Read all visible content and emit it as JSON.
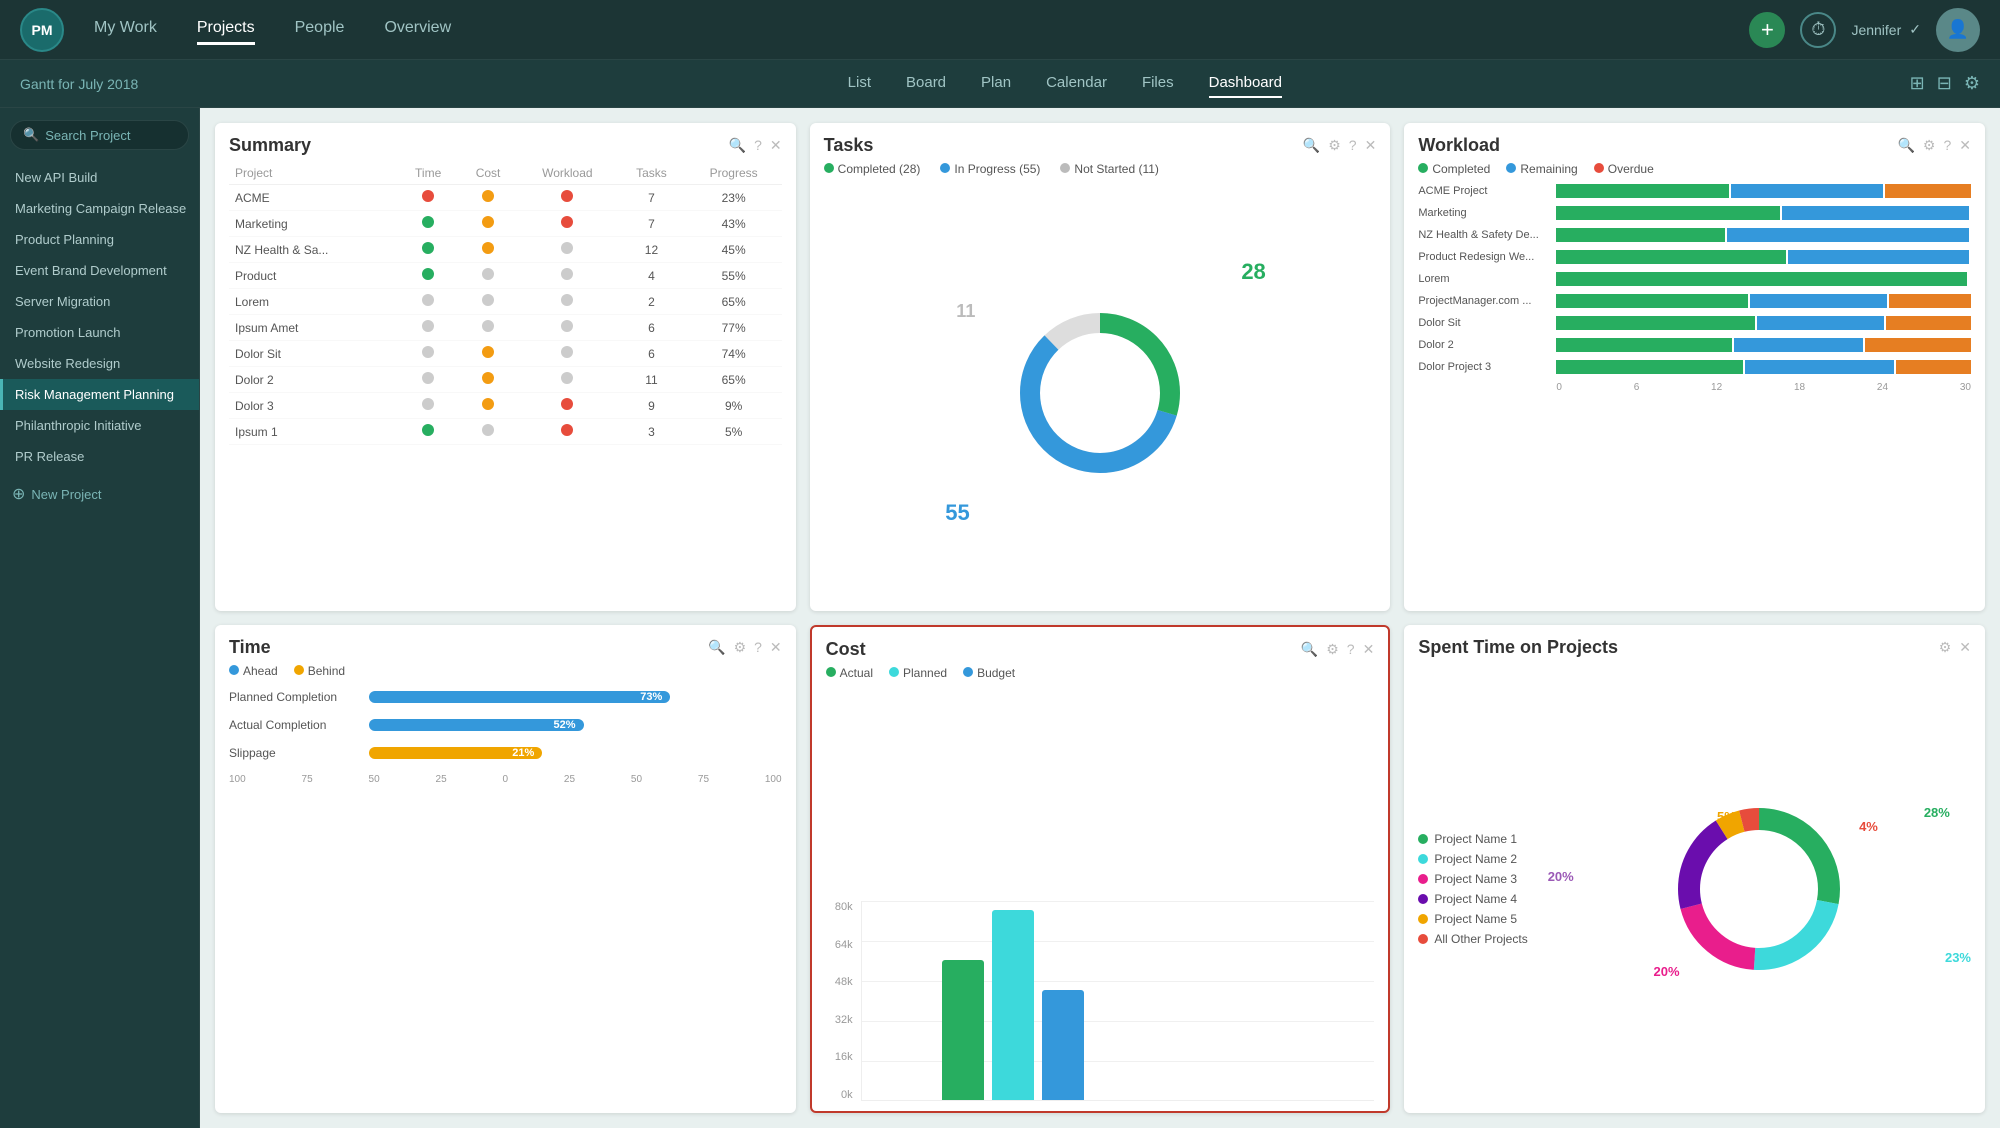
{
  "nav": {
    "logo": "PM",
    "items": [
      {
        "label": "My Work",
        "active": false
      },
      {
        "label": "Projects",
        "active": true
      },
      {
        "label": "People",
        "active": false
      },
      {
        "label": "Overview",
        "active": false
      }
    ],
    "user": "Jennifer",
    "add_icon": "+",
    "clock_icon": "⏱"
  },
  "subnav": {
    "gantt_title": "Gantt for July 2018",
    "items": [
      {
        "label": "List",
        "active": false
      },
      {
        "label": "Board",
        "active": false
      },
      {
        "label": "Plan",
        "active": false
      },
      {
        "label": "Calendar",
        "active": false
      },
      {
        "label": "Files",
        "active": false
      },
      {
        "label": "Dashboard",
        "active": true
      }
    ]
  },
  "sidebar": {
    "search_placeholder": "Search Project",
    "items": [
      {
        "label": "New API Build",
        "active": false
      },
      {
        "label": "Marketing Campaign Release",
        "active": false
      },
      {
        "label": "Product Planning",
        "active": false
      },
      {
        "label": "Event Brand Development",
        "active": false
      },
      {
        "label": "Server Migration",
        "active": false
      },
      {
        "label": "Promotion Launch",
        "active": false
      },
      {
        "label": "Website Redesign",
        "active": false
      },
      {
        "label": "Risk Management Planning",
        "active": true
      },
      {
        "label": "Philanthropic Initiative",
        "active": false
      },
      {
        "label": "PR Release",
        "active": false
      }
    ],
    "new_project": "New Project"
  },
  "widgets": {
    "summary": {
      "title": "Summary",
      "columns": [
        "Project",
        "Time",
        "Cost",
        "Workload",
        "Tasks",
        "Progress"
      ],
      "rows": [
        {
          "name": "ACME",
          "time": "red",
          "cost": "yellow",
          "workload": "red",
          "tasks": 7,
          "progress": "23%"
        },
        {
          "name": "Marketing",
          "time": "green",
          "cost": "yellow",
          "workload": "red",
          "tasks": 7,
          "progress": "43%"
        },
        {
          "name": "NZ Health & Sa...",
          "time": "green",
          "cost": "yellow",
          "workload": "gray",
          "tasks": 12,
          "progress": "45%"
        },
        {
          "name": "Product",
          "time": "green",
          "cost": "gray",
          "workload": "gray",
          "tasks": 4,
          "progress": "55%"
        },
        {
          "name": "Lorem",
          "time": "gray",
          "cost": "gray",
          "workload": "gray",
          "tasks": 2,
          "progress": "65%"
        },
        {
          "name": "Ipsum Amet",
          "time": "gray",
          "cost": "gray",
          "workload": "gray",
          "tasks": 6,
          "progress": "77%"
        },
        {
          "name": "Dolor Sit",
          "time": "gray",
          "cost": "yellow",
          "workload": "gray",
          "tasks": 6,
          "progress": "74%"
        },
        {
          "name": "Dolor 2",
          "time": "gray",
          "cost": "yellow",
          "workload": "gray",
          "tasks": 11,
          "progress": "65%"
        },
        {
          "name": "Dolor 3",
          "time": "gray",
          "cost": "yellow",
          "workload": "red",
          "tasks": 9,
          "progress": "9%"
        },
        {
          "name": "Ipsum 1",
          "time": "green",
          "cost": "gray",
          "workload": "red",
          "tasks": 3,
          "progress": "5%"
        }
      ]
    },
    "tasks": {
      "title": "Tasks",
      "completed": {
        "label": "Completed",
        "count": 28,
        "color": "#27ae60"
      },
      "in_progress": {
        "label": "In Progress",
        "count": 55,
        "color": "#3498db"
      },
      "not_started": {
        "label": "Not Started",
        "count": 11,
        "color": "#bbb"
      },
      "center_main": "28",
      "center_small": "55",
      "center_top": "11"
    },
    "workload": {
      "title": "Workload",
      "legend": [
        {
          "label": "Completed",
          "color": "#27ae60"
        },
        {
          "label": "Remaining",
          "color": "#3498db"
        },
        {
          "label": "Overdue",
          "color": "#e74c3c"
        }
      ],
      "rows": [
        {
          "label": "ACME Project",
          "green": 40,
          "blue": 35,
          "orange": 20
        },
        {
          "label": "Marketing",
          "green": 30,
          "blue": 25,
          "orange": 0
        },
        {
          "label": "NZ Health & Safety De...",
          "green": 35,
          "blue": 50,
          "orange": 0
        },
        {
          "label": "Product Redesign We...",
          "green": 38,
          "blue": 30,
          "orange": 0
        },
        {
          "label": "Lorem",
          "green": 55,
          "blue": 0,
          "orange": 0
        },
        {
          "label": "ProjectManager.com ...",
          "green": 35,
          "blue": 25,
          "orange": 15
        },
        {
          "label": "Dolor Sit",
          "green": 28,
          "blue": 18,
          "orange": 12
        },
        {
          "label": "Dolor 2",
          "green": 30,
          "blue": 22,
          "orange": 18
        },
        {
          "label": "Dolor Project 3",
          "green": 25,
          "blue": 20,
          "orange": 10
        }
      ],
      "axis": [
        0,
        6,
        12,
        18,
        24,
        30
      ]
    },
    "time": {
      "title": "Time",
      "legend": [
        {
          "label": "Ahead",
          "color": "#3498db"
        },
        {
          "label": "Behind",
          "color": "#f0a500"
        }
      ],
      "bars": [
        {
          "label": "Planned Completion",
          "value": 73,
          "color": "blue",
          "pct": "73%"
        },
        {
          "label": "Actual Completion",
          "value": 52,
          "color": "blue",
          "pct": "52%"
        },
        {
          "label": "Slippage",
          "value": 21,
          "color": "gold",
          "pct": "21%"
        }
      ],
      "axis": [
        "100",
        "75",
        "50",
        "25",
        "0",
        "25",
        "50",
        "75",
        "100"
      ]
    },
    "cost": {
      "title": "Cost",
      "highlighted": true,
      "legend": [
        {
          "label": "Actual",
          "color": "#27ae60"
        },
        {
          "label": "Planned",
          "color": "#3dd9db"
        },
        {
          "label": "Budget",
          "color": "#3498db"
        }
      ],
      "yaxis": [
        "80k",
        "64k",
        "48k",
        "32k",
        "16k",
        "0k"
      ],
      "bars": [
        {
          "actual_h": 140,
          "planned_h": 190,
          "budget_h": 110
        }
      ]
    },
    "spent_time": {
      "title": "Spent Time on Projects",
      "legend": [
        {
          "label": "Project Name 1",
          "color": "#27ae60",
          "pct": "28%"
        },
        {
          "label": "Project Name 2",
          "color": "#3dd9db",
          "pct": "23%"
        },
        {
          "label": "Project Name 3",
          "color": "#e91e8c",
          "pct": "20%"
        },
        {
          "label": "Project Name 4",
          "color": "#6a0dad",
          "pct": "20%"
        },
        {
          "label": "Project Name 5",
          "color": "#f0a500",
          "pct": "5%"
        },
        {
          "label": "All Other Projects",
          "color": "#e74c3c",
          "pct": "4%"
        }
      ]
    }
  }
}
